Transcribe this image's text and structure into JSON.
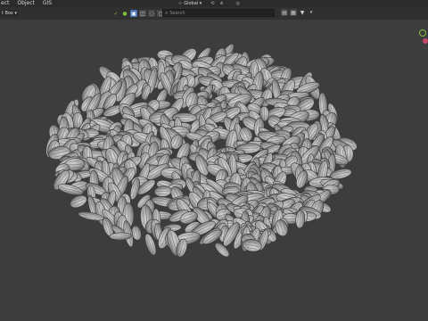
{
  "menubar": {
    "items": [
      "ect",
      "Object",
      "GIS"
    ]
  },
  "toolbar": {
    "mode_label": "t Box ▾",
    "orientation_label": "Global ▾",
    "search_placeholder": "Search"
  },
  "colors": {
    "background": "#3d3d3d",
    "menubar": "#2b2b2b",
    "toolbar": "#303030",
    "active_button": "#4772b3",
    "gizmo_y": "#7ec23d",
    "gizmo_z": "#c2496b"
  },
  "icons": [
    "checkmark-icon",
    "select-icon",
    "box-select-icon",
    "lasso-icon",
    "circle-select-icon",
    "tweak-icon",
    "search-icon",
    "transform-icon",
    "snap-icon",
    "proportional-icon",
    "overlay-icon",
    "filter-icon"
  ]
}
